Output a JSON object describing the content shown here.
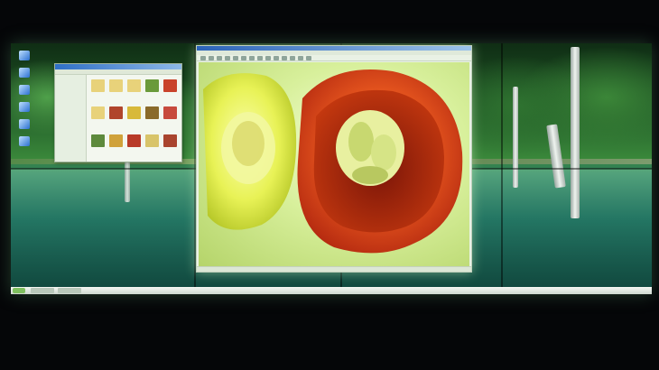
{
  "scene": {
    "description_hidden": "",
    "colors": {
      "forest": "#2f7d3a",
      "lake": "#1a5a4a",
      "pepper_red": "#e0461e",
      "pepper_yellow": "#e6f25a"
    }
  },
  "desktop": {
    "icons": [
      {
        "name": "computer-icon",
        "label": ""
      },
      {
        "name": "documents-icon",
        "label": ""
      },
      {
        "name": "network-icon",
        "label": ""
      },
      {
        "name": "recycle-bin-icon",
        "label": ""
      },
      {
        "name": "ie-icon",
        "label": ""
      },
      {
        "name": "folder-icon",
        "label": ""
      }
    ]
  },
  "viewer": {
    "title": "",
    "menu": ""
  },
  "taskbar": {
    "clock": ""
  }
}
